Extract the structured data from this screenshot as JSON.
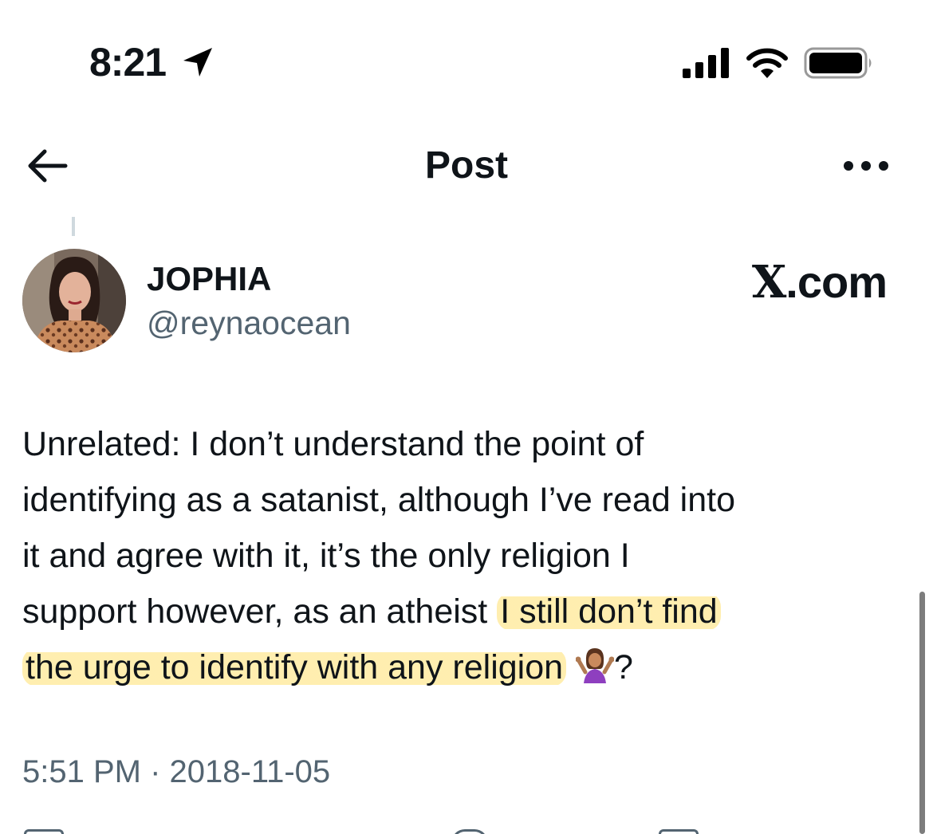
{
  "status_bar": {
    "time": "8:21",
    "location_icon": "location-arrow-icon",
    "signal_icon": "cellular-signal-icon",
    "wifi_icon": "wifi-icon",
    "battery_icon": "battery-full-icon"
  },
  "header": {
    "title": "Post",
    "back_icon": "arrow-left-icon",
    "more_icon": "more-horizontal-icon"
  },
  "author": {
    "display_name": "JOPHIA",
    "handle": "@reynaocean"
  },
  "watermark": {
    "x_letter": "X",
    "rest": ".com"
  },
  "post": {
    "line1": "Unrelated: I don’t understand the point of",
    "line2": "identifying as a satanist, although I’ve read into",
    "line3": "it and agree with it, it’s the only religion I",
    "line4_plain": "support however, as an atheist",
    "line4_highlight": "I still don’t find",
    "line5_highlight": "the urge to identify with any religion",
    "emoji": "person-shrugging-emoji",
    "line5_suffix": "?",
    "highlight_color": "#ffe06e"
  },
  "timestamp": "5:51 PM · 2018-11-05",
  "colors": {
    "text": "#0f1419",
    "secondary": "#536471"
  }
}
